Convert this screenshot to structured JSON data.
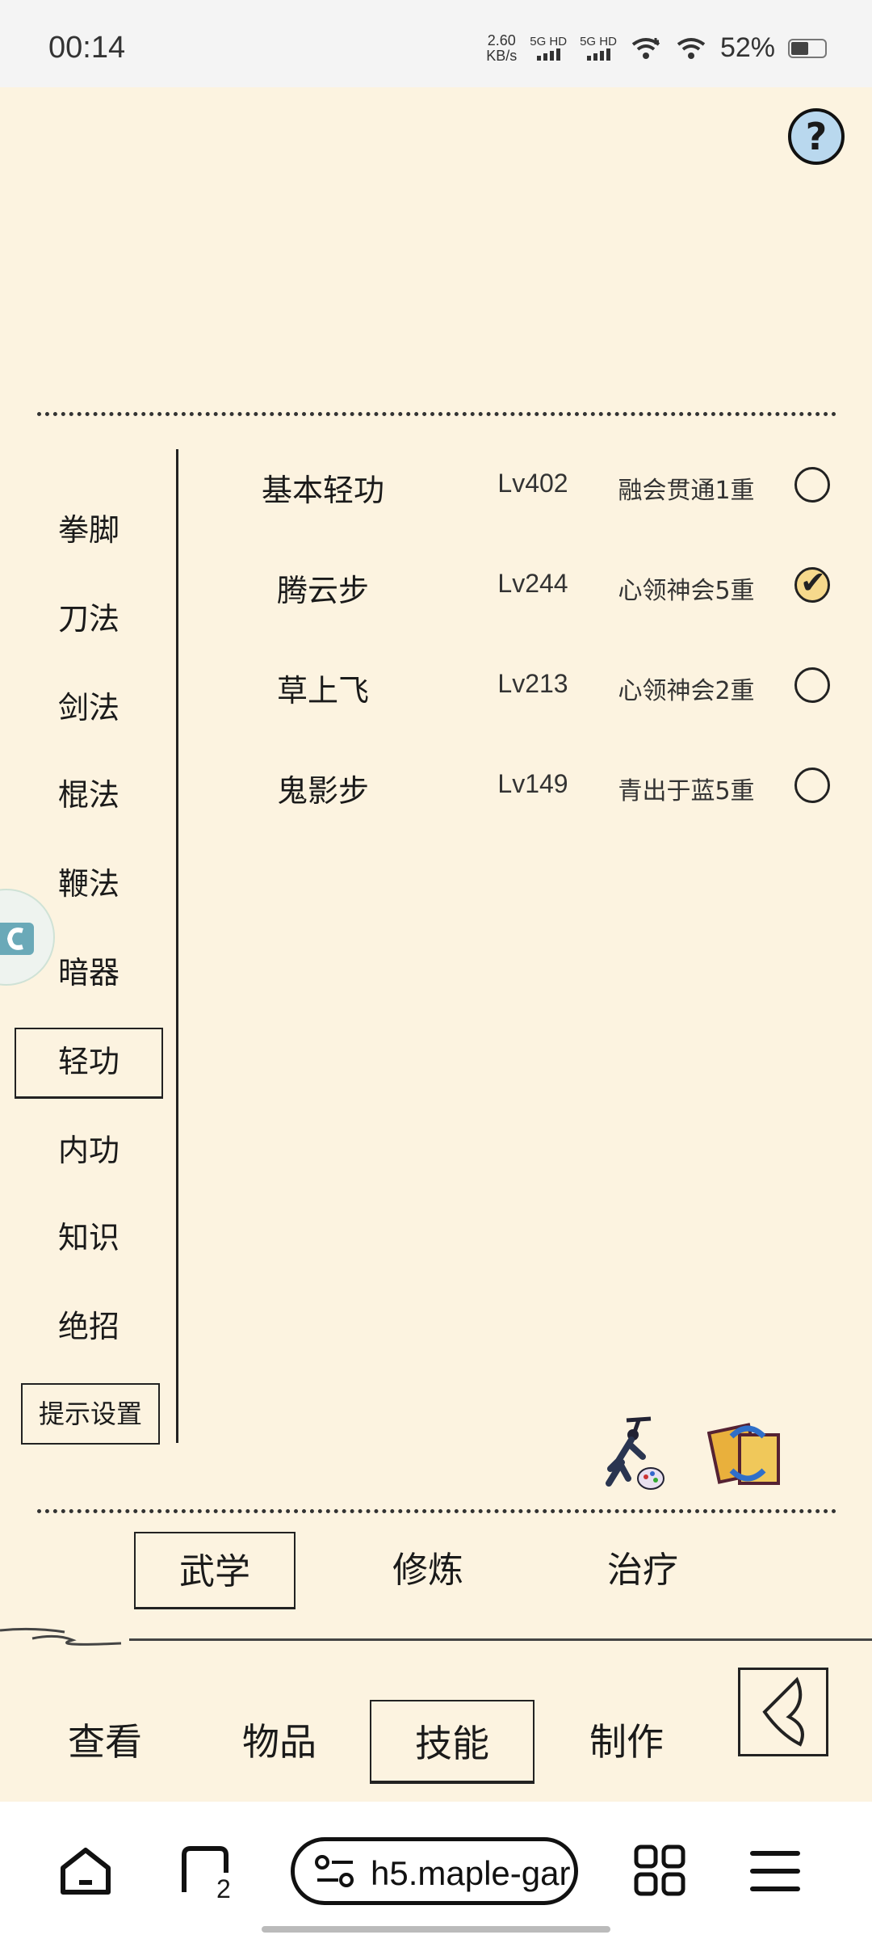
{
  "status_bar": {
    "time": "00:14",
    "net_speed_value": "2.60",
    "net_speed_unit": "KB/s",
    "sim1_label": "5G HD",
    "sim2_label": "5G HD",
    "battery_percent": "52%",
    "battery_level": 0.52
  },
  "game": {
    "help_label": "?",
    "categories": [
      {
        "label": "拳脚"
      },
      {
        "label": "刀法"
      },
      {
        "label": "剑法"
      },
      {
        "label": "棍法"
      },
      {
        "label": "鞭法"
      },
      {
        "label": "暗器"
      },
      {
        "label": "轻功",
        "selected": true
      },
      {
        "label": "内功"
      },
      {
        "label": "知识"
      },
      {
        "label": "绝招"
      }
    ],
    "hint_settings_label": "提示设置",
    "skills": [
      {
        "name": "基本轻功",
        "level": "Lv402",
        "state": "融会贯通1重",
        "checked": false
      },
      {
        "name": "腾云步",
        "level": "Lv244",
        "state": "心领神会5重",
        "checked": true
      },
      {
        "name": "草上飞",
        "level": "Lv213",
        "state": "心领神会2重",
        "checked": false
      },
      {
        "name": "鬼影步",
        "level": "Lv149",
        "state": "青出于蓝5重",
        "checked": false
      }
    ],
    "sub_tabs": [
      {
        "label": "武学",
        "selected": true
      },
      {
        "label": "修炼",
        "selected": false
      },
      {
        "label": "治疗",
        "selected": false
      }
    ],
    "main_tabs": [
      {
        "label": "查看",
        "selected": false
      },
      {
        "label": "物品",
        "selected": false
      },
      {
        "label": "技能",
        "selected": true
      },
      {
        "label": "制作",
        "selected": false
      }
    ],
    "colors": {
      "background": "#fcf3e0",
      "ink": "#1a1a1a",
      "help_fill": "#b9d8ee",
      "checked_fill": "#f6d98c"
    }
  },
  "browser": {
    "url_text": "h5.maple-gar",
    "tab_count": "2"
  }
}
